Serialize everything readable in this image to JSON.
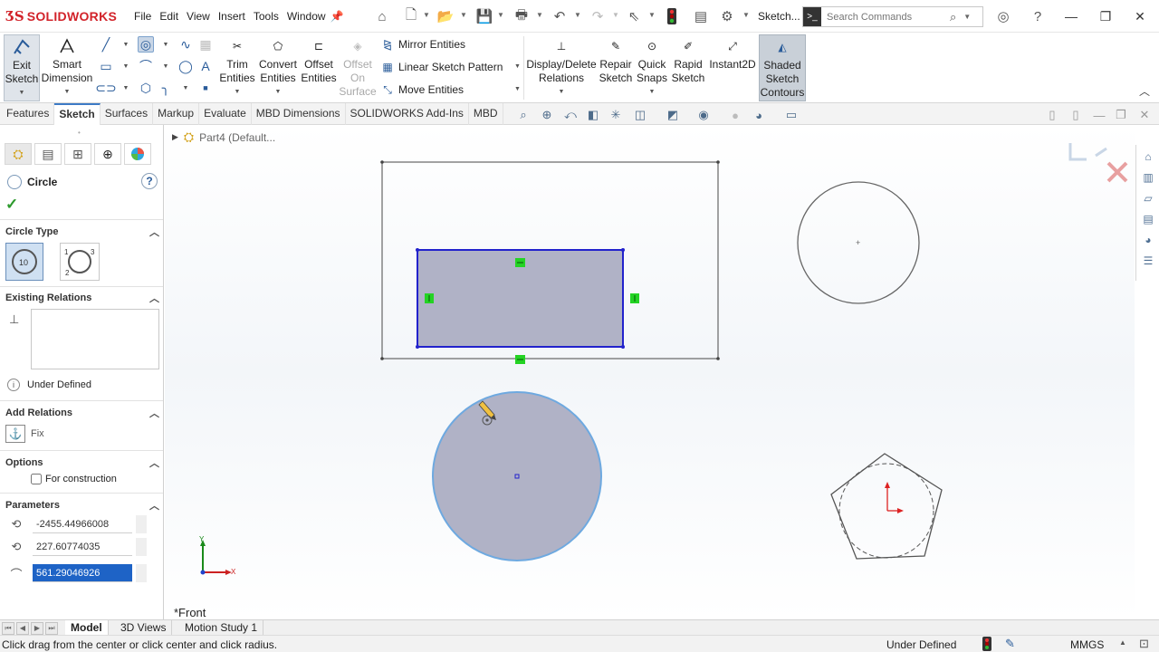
{
  "app": {
    "brand": "SOLIDWORKS",
    "document": "Sketch..."
  },
  "menu": [
    "File",
    "Edit",
    "View",
    "Insert",
    "Tools",
    "Window"
  ],
  "search": {
    "placeholder": "Search Commands"
  },
  "ribbon": {
    "exit_sketch": "Exit Sketch",
    "smart_dimension": "Smart Dimension",
    "trim_entities": "Trim Entities",
    "convert_entities": "Convert Entities",
    "offset_entities": "Offset Entities",
    "offset_on_surface": "Offset On Surface",
    "mirror_entities": "Mirror Entities",
    "linear_sketch_pattern": "Linear Sketch Pattern",
    "move_entities": "Move Entities",
    "display_delete_relations": "Display/Delete Relations",
    "repair_sketch": "Repair Sketch",
    "quick_snaps": "Quick Snaps",
    "rapid_sketch": "Rapid Sketch",
    "instant2d": "Instant2D",
    "shaded_sketch_contours": "Shaded Sketch Contours"
  },
  "tabs": [
    "Features",
    "Sketch",
    "Surfaces",
    "Markup",
    "Evaluate",
    "MBD Dimensions",
    "SOLIDWORKS Add-Ins",
    "MBD"
  ],
  "active_tab": "Sketch",
  "property_manager": {
    "title": "Circle",
    "circle_type_label": "Circle Type",
    "existing_relations_label": "Existing Relations",
    "status": "Under Defined",
    "add_relations_label": "Add Relations",
    "fix_label": "Fix",
    "options_label": "Options",
    "for_construction_label": "For construction",
    "for_construction_checked": false,
    "parameters_label": "Parameters",
    "param_x": "-2455.44966008",
    "param_y": "227.60774035",
    "param_radius": "561.29046926"
  },
  "graphics": {
    "tree_label": "Part4 (Default...",
    "view_name": "*Front",
    "axis_x": "X",
    "axis_y": "Y"
  },
  "model_tabs": [
    "Model",
    "3D Views",
    "Motion Study 1"
  ],
  "active_model_tab": "Model",
  "statusbar": {
    "hint": "Click drag from the center or click center and click radius.",
    "state": "Under Defined",
    "units": "MMGS"
  },
  "colors": {
    "brand_red": "#d2232a",
    "selection_blue": "#1e63c6",
    "sketch_blue": "#2222cc",
    "shaded_fill": "#b0b2c6",
    "relation_green": "#24d324"
  }
}
